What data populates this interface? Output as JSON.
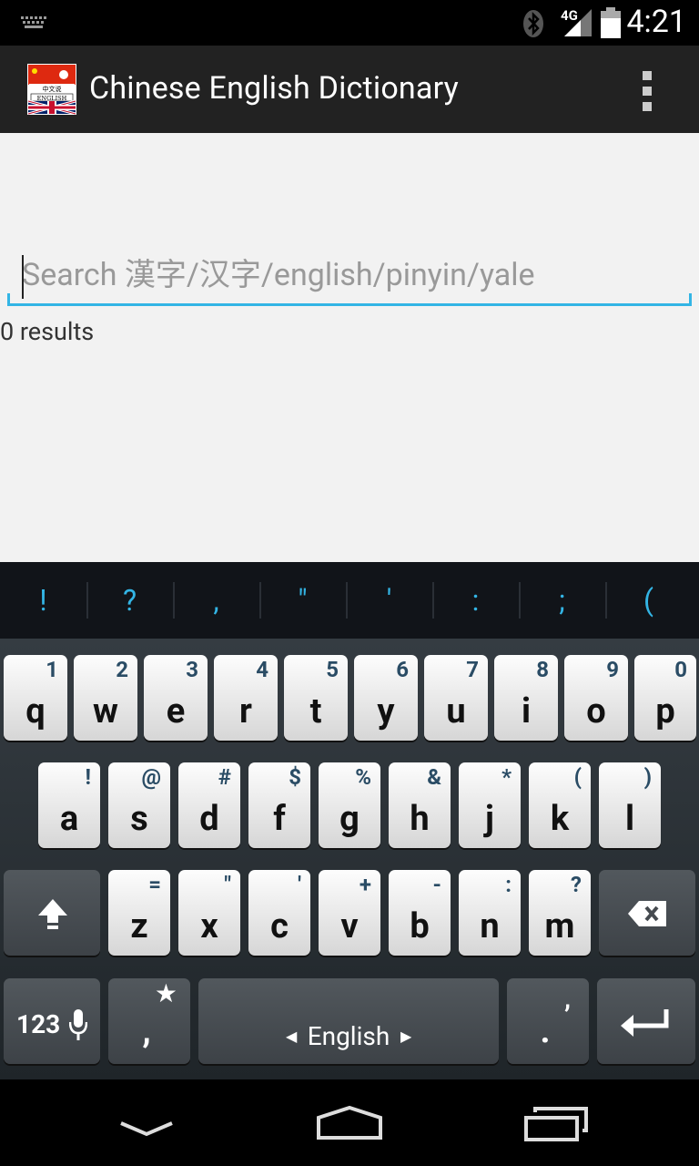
{
  "status_bar": {
    "time": "4:21",
    "network": "4G",
    "icons": [
      "keyboard-icon",
      "bluetooth-icon",
      "signal-icon",
      "battery-icon"
    ]
  },
  "action_bar": {
    "title": "Chinese English Dictionary",
    "app_icon_text": "中文说\nENGLISH"
  },
  "search": {
    "value": "",
    "placeholder": "Search 漢字/汉字/english/pinyin/yale"
  },
  "results_label": "0 results",
  "suggestions": [
    "!",
    "?",
    ",",
    "\"",
    "'",
    ":",
    ";",
    "("
  ],
  "keyboard": {
    "row1": [
      {
        "key": "q",
        "hint": "1"
      },
      {
        "key": "w",
        "hint": "2"
      },
      {
        "key": "e",
        "hint": "3"
      },
      {
        "key": "r",
        "hint": "4"
      },
      {
        "key": "t",
        "hint": "5"
      },
      {
        "key": "y",
        "hint": "6"
      },
      {
        "key": "u",
        "hint": "7"
      },
      {
        "key": "i",
        "hint": "8"
      },
      {
        "key": "o",
        "hint": "9"
      },
      {
        "key": "p",
        "hint": "0"
      }
    ],
    "row2": [
      {
        "key": "a",
        "hint": "!"
      },
      {
        "key": "s",
        "hint": "@"
      },
      {
        "key": "d",
        "hint": "#"
      },
      {
        "key": "f",
        "hint": "$"
      },
      {
        "key": "g",
        "hint": "%"
      },
      {
        "key": "h",
        "hint": "&"
      },
      {
        "key": "j",
        "hint": "*"
      },
      {
        "key": "k",
        "hint": "("
      },
      {
        "key": "l",
        "hint": ")"
      }
    ],
    "row3": [
      {
        "key": "z",
        "hint": "="
      },
      {
        "key": "x",
        "hint": "\""
      },
      {
        "key": "c",
        "hint": "'"
      },
      {
        "key": "v",
        "hint": "+"
      },
      {
        "key": "b",
        "hint": "-"
      },
      {
        "key": "n",
        "hint": ":"
      },
      {
        "key": "m",
        "hint": "?"
      }
    ],
    "symbols_label": "123",
    "comma_key": ",",
    "comma_hint": "★",
    "space_label": "English",
    "period_key": ".",
    "period_hint": ","
  },
  "colors": {
    "accent": "#33b5e5",
    "action_bar": "#222222",
    "background": "#f2f2f2"
  }
}
